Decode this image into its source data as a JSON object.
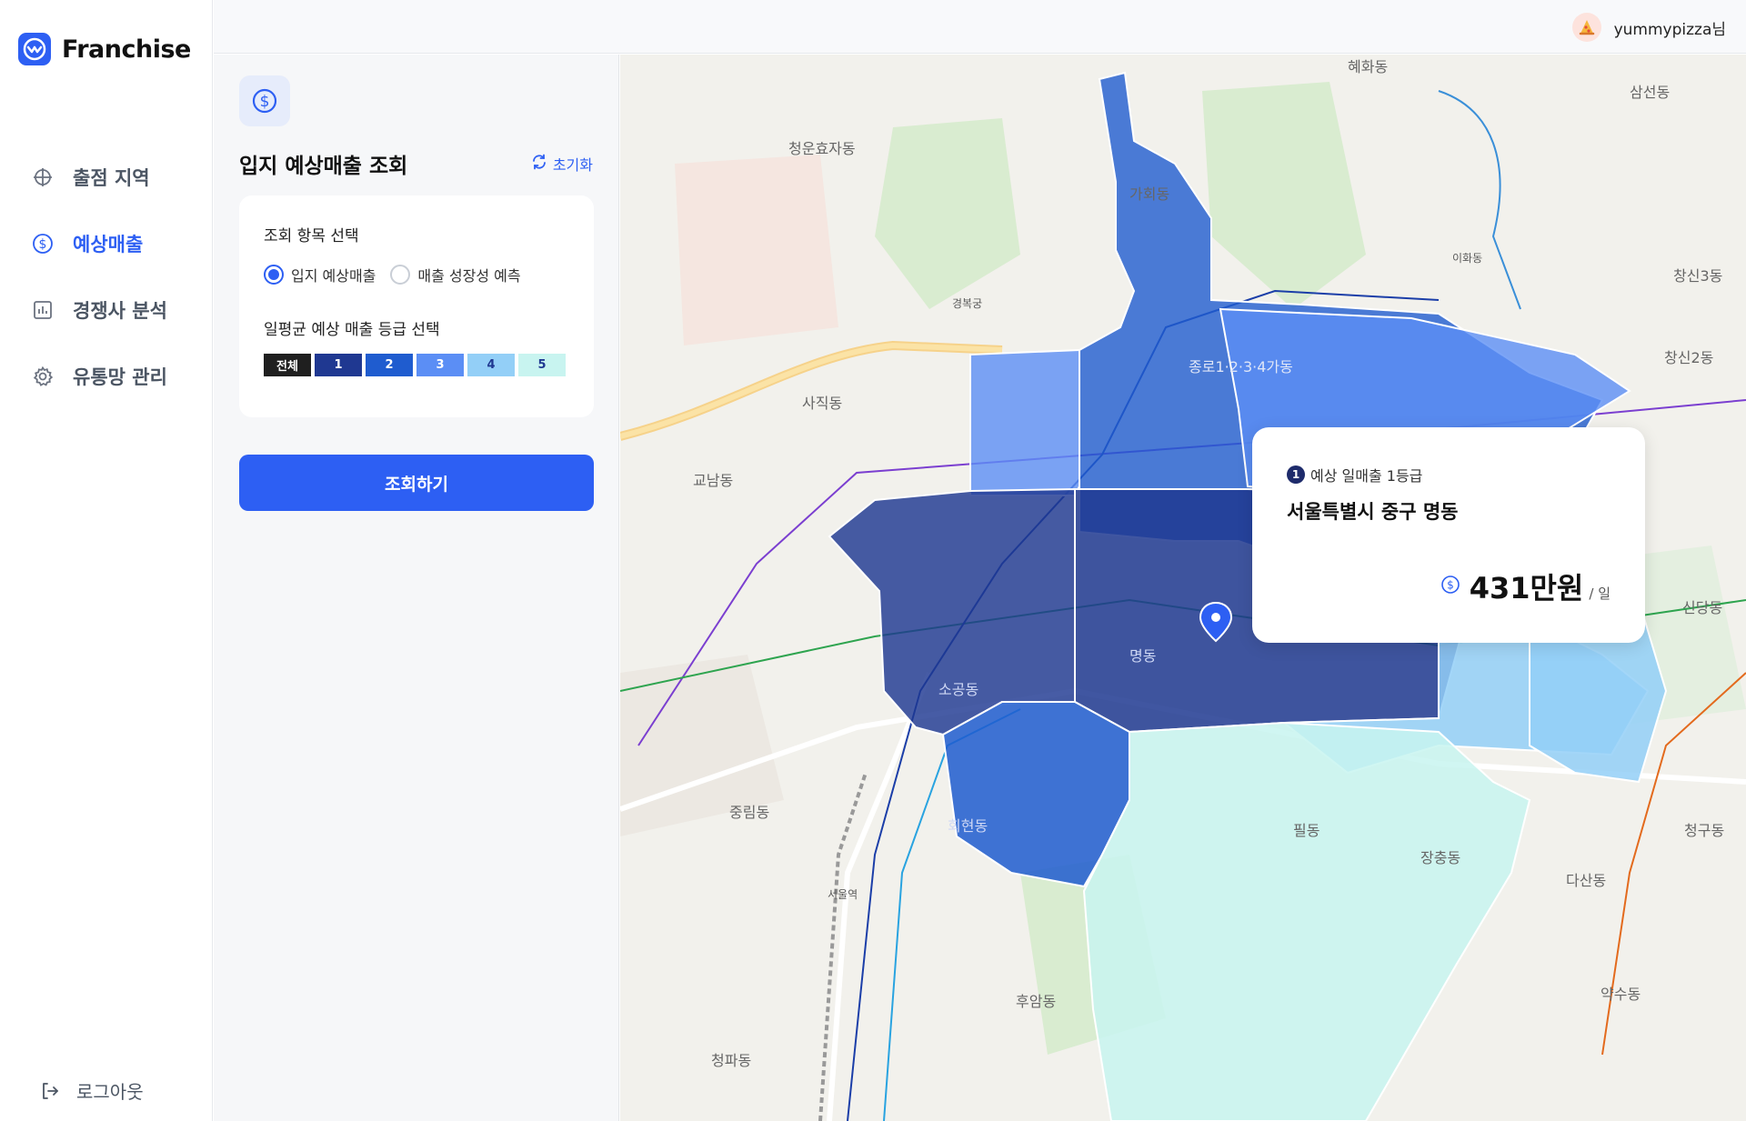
{
  "brand": {
    "name": "Franchise"
  },
  "nav": {
    "items": [
      {
        "label": "출점 지역",
        "icon": "crosshair-icon",
        "active": false
      },
      {
        "label": "예상매출",
        "icon": "dollar-circle-icon",
        "active": true
      },
      {
        "label": "경쟁사 분석",
        "icon": "bar-chart-icon",
        "active": false
      },
      {
        "label": "유통망 관리",
        "icon": "gear-icon",
        "active": false
      }
    ],
    "logout_label": "로그아웃"
  },
  "header": {
    "user_name": "yummypizza님"
  },
  "panel": {
    "title": "입지 예상매출 조회",
    "reset_label": "초기화",
    "select_label": "조회 항목 선택",
    "options": [
      {
        "label": "입지 예상매출",
        "checked": true
      },
      {
        "label": "매출 성장성 예측",
        "checked": false
      }
    ],
    "grade_label": "일평균 예상 매출 등급 선택",
    "grades": [
      {
        "label": "전체",
        "color": "#1f1f1f",
        "text_color": "#ffffff"
      },
      {
        "label": "1",
        "color": "#1f3891",
        "text_color": "#ffffff"
      },
      {
        "label": "2",
        "color": "#1f5ccf",
        "text_color": "#ffffff"
      },
      {
        "label": "3",
        "color": "#5b8ef5",
        "text_color": "#ffffff"
      },
      {
        "label": "4",
        "color": "#93cff7",
        "text_color": "#1f3891"
      },
      {
        "label": "5",
        "color": "#c8f4f0",
        "text_color": "#1f3891"
      }
    ],
    "submit_label": "조회하기"
  },
  "map": {
    "labels": {
      "hyehwa": "혜화동",
      "samseon": "삼선동",
      "cheongunhyoja": "청운효자동",
      "gahoe": "가회동",
      "changsin3": "창신3동",
      "changsin2": "창신2동",
      "jongno1234": "종로1·2·3·4가동",
      "sajik": "사직동",
      "gyonam": "교남동",
      "sogong": "소공동",
      "myeong": "명동",
      "hoehyeon": "회현동",
      "jungnim": "중림동",
      "phil": "필동",
      "jangchung": "장충동",
      "huam": "후암동",
      "dasan": "다산동",
      "yaksu": "약수동",
      "cheonggu": "청구동",
      "sindang": "신당동",
      "cheongpa": "청파동",
      "gyeongbokgung": "경복궁",
      "leehwa": "이화동",
      "seoul_station": "서울역"
    }
  },
  "popup": {
    "grade_number": "1",
    "grade_text": "예상 일매출 1등급",
    "address": "서울특별시 중구 명동",
    "sales_value": "431만원",
    "sales_unit": "/ 일"
  },
  "colors": {
    "primary": "#2d5ff3",
    "grade1": "#1f3891",
    "grade2": "#1f5ccf",
    "grade3": "#5b8ef5",
    "grade4": "#93cff7",
    "grade5": "#c8f4f0"
  }
}
